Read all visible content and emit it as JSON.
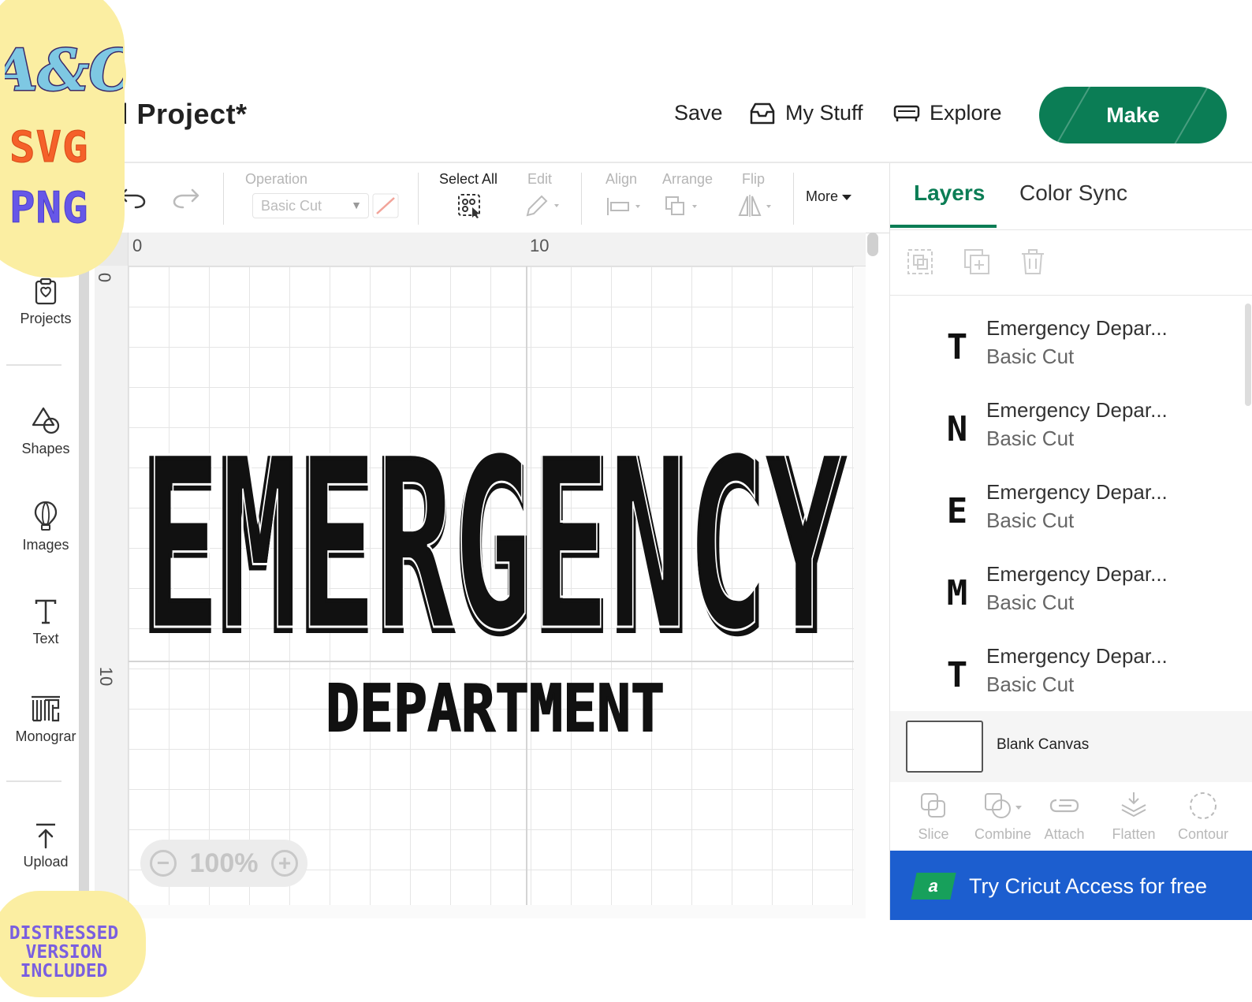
{
  "brand": {
    "logo_text": "A&C",
    "format_1": "SVG",
    "format_2": "PNG",
    "distressed_note": "DISTRESSED VERSION INCLUDED"
  },
  "header": {
    "title": "ed Project*",
    "save_label": "Save",
    "mystuff_label": "My Stuff",
    "explore_label": "Explore",
    "make_label": "Make",
    "make_color": "#0b7d55"
  },
  "toolbar": {
    "operation_label": "Operation",
    "operation_value": "Basic Cut",
    "select_all_label": "Select All",
    "edit_label": "Edit",
    "align_label": "Align",
    "arrange_label": "Arrange",
    "flip_label": "Flip",
    "more_label": "More"
  },
  "sidebar": {
    "items": [
      {
        "label": "Projects",
        "icon": "projects-icon"
      },
      {
        "label": "Shapes",
        "icon": "shapes-icon"
      },
      {
        "label": "Images",
        "icon": "images-icon"
      },
      {
        "label": "Text",
        "icon": "text-icon"
      },
      {
        "label": "Monograr",
        "icon": "monogram-icon"
      },
      {
        "label": "Upload",
        "icon": "upload-icon"
      }
    ]
  },
  "canvas": {
    "ruler_top": [
      "0",
      "10"
    ],
    "ruler_left": [
      "0",
      "10"
    ],
    "zoom": "100%",
    "design_line_1": "EMERGENCY",
    "design_line_2": "DEPARTMENT"
  },
  "panel": {
    "tab_layers": "Layers",
    "tab_color_sync": "Color Sync",
    "layers": [
      {
        "glyph": "T",
        "name": "Emergency Depar...",
        "op": "Basic Cut"
      },
      {
        "glyph": "N",
        "name": "Emergency Depar...",
        "op": "Basic Cut"
      },
      {
        "glyph": "E",
        "name": "Emergency Depar...",
        "op": "Basic Cut"
      },
      {
        "glyph": "M",
        "name": "Emergency Depar...",
        "op": "Basic Cut"
      },
      {
        "glyph": "T",
        "name": "Emergency Depar...",
        "op": "Basic Cut"
      }
    ],
    "blank_canvas_label": "Blank Canvas",
    "actions": [
      "Slice",
      "Combine",
      "Attach",
      "Flatten",
      "Contour"
    ],
    "access_badge": "a",
    "access_text": "Try Cricut Access for free",
    "access_color": "#1c5ecf"
  }
}
